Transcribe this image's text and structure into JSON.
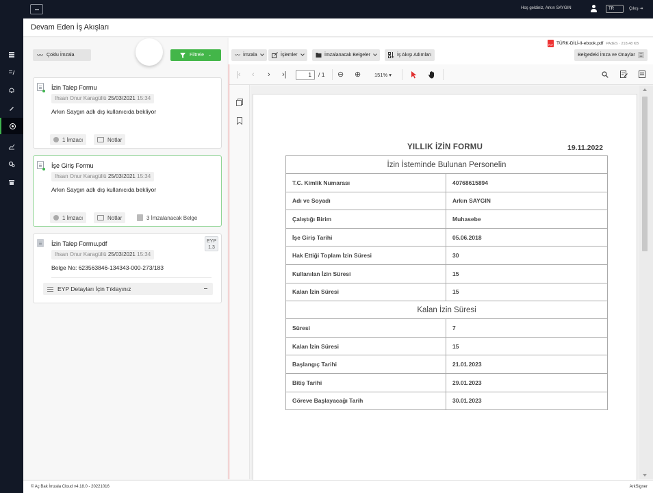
{
  "header": {
    "welcome_text": "Hoş geldiniz, Arkın SAYGIN",
    "language": "TR",
    "logout_label": "Çıkış"
  },
  "page": {
    "title": "Devam Eden İş Akışları"
  },
  "left_toolbar": {
    "bulk_sign_label": "Çoklu İmzala",
    "filter_label": "Filtrele"
  },
  "cards": [
    {
      "title": "İzin Talep Formu",
      "author": "Ihsan Onur Karagüllü",
      "date": "25/03/2021",
      "time": "15:34",
      "description": "Arkın Saygın adlı dış kullanıcıda bekliyor",
      "signer_count": "1 İmzacı",
      "notes_label": "Notlar"
    },
    {
      "title": "İşe Giriş Formu",
      "author": "Ihsan Onur Karagüllü",
      "date": "25/03/2021",
      "time": "15:34",
      "description": "Arkın Saygın adlı dış kullanıcıda bekliyor",
      "signer_count": "1 İmzacı",
      "notes_label": "Notlar",
      "docs_to_sign": "3 İmzalanacak Belge"
    },
    {
      "title": "İzin Talep Formu.pdf",
      "author": "Ihsan Onur Karagüllü",
      "date": "25/03/2021",
      "time": "15:34",
      "document_no": "Belge No: 623563846-134343-000-273/183",
      "eyp_badge_line1": "EYP",
      "eyp_badge_line2": "1.3",
      "eyp_details_label": "EYP Detayları İçin Tıklayınız"
    }
  ],
  "doc_toolbar": {
    "file_name": "TÜRK-DİLİ-II-ebook.pdf",
    "file_type_icon": "PDF",
    "file_size": "PAdES · 218,48 KB",
    "sign_label": "İmzala",
    "actions_label": "İşlemler",
    "to_sign_docs_label": "İmzalanacak Belgeler",
    "workflow_steps_label": "İş Akışı Adımları",
    "signatures_label": "Belgedeki İmza ve Onaylar"
  },
  "viewer": {
    "current_page": "1",
    "page_total": "/ 1",
    "zoom": "151%"
  },
  "form": {
    "title": "YILLIK İZİN FORMU",
    "date": "19.11.2022",
    "section1_title": "İzin İsteminde Bulunan Personelin",
    "rows1": [
      {
        "label": "T.C. Kimlik Numarası",
        "value": "40768615894"
      },
      {
        "label": "Adı ve Soyadı",
        "value": "Arkın SAYGIN"
      },
      {
        "label": "Çalıştığı Birim",
        "value": "Muhasebe"
      },
      {
        "label": "İşe Giriş Tarihi",
        "value": "05.06.2018"
      },
      {
        "label": "Hak Ettiği Toplam İzin Süresi",
        "value": "30"
      },
      {
        "label": "Kullanılan İzin Süresi",
        "value": "15"
      },
      {
        "label": "Kalan İzin Süresi",
        "value": "15"
      }
    ],
    "section2_title": "Kalan İzin Süresi",
    "rows2": [
      {
        "label": "Süresi",
        "value": "7"
      },
      {
        "label": "Kalan İzin Süresi",
        "value": "15"
      },
      {
        "label": "Başlangıç Tarihi",
        "value": "21.01.2023"
      },
      {
        "label": "Bitiş Tarihi",
        "value": "29.01.2023"
      },
      {
        "label": "Göreve Başlayacağı Tarih",
        "value": "30.01.2023"
      }
    ]
  },
  "footer": {
    "left_text": "© Aç Bak İmzala Cloud v4.18.0 - 20221016",
    "right_text": "ArkSigner"
  },
  "colors": {
    "top_bar": "#121826",
    "accent_green": "#43b649",
    "viewer_left_border": "#ee8888"
  }
}
